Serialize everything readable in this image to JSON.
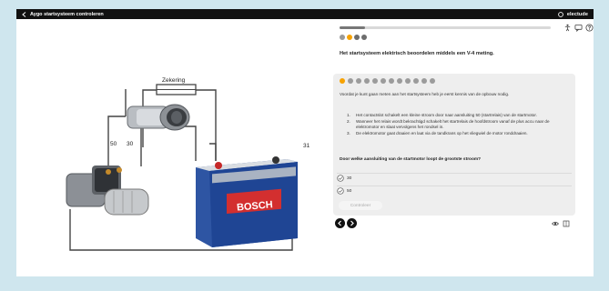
{
  "header": {
    "back_icon": "chevron-left-icon",
    "title": "Aygo startsysteem controleren",
    "brand": "electude"
  },
  "progress": {
    "fraction": 0.12
  },
  "steps": {
    "count": 4,
    "active_index": 1
  },
  "top_icons": [
    "accessibility-icon",
    "chat-icon",
    "help-icon"
  ],
  "section_title": "Het startsysteem elektrisch beoordelen middels een V-4 meting.",
  "diagram": {
    "fuse_label": "Zekering",
    "terminal_50": "50",
    "terminal_30": "30",
    "terminal_31": "31",
    "battery_brand": "BOSCH"
  },
  "question_card": {
    "dot_count": 12,
    "active_dot": 0,
    "intro": "Voordat je kunt gaan meten aan het startsysteem heb je eerst kennis van de opbouw nodig.",
    "steps": [
      {
        "n": "1.",
        "text": "Het contactslot schakelt een kleine stroom door naar aansluiting 50 (startrelais) van de startmotor."
      },
      {
        "n": "2.",
        "text": "Wanneer het relais wordt bekrachtigd schakelt het startrelais de hoofdstroom vanaf de plus accu naar de elektromotor en slaat vervolgens het rondsel in."
      },
      {
        "n": "3.",
        "text": "De elektromotor gaat draaien en laat via de tandkrans op het vliegwiel de motor ronddraaien."
      }
    ],
    "question": "Door welke aansluiting van de startmotor loopt de grootste stroom?",
    "options": [
      "30",
      "50"
    ],
    "check_label": "Controleer"
  },
  "nav": {
    "prev_icon": "arrow-left-icon",
    "next_icon": "arrow-right-icon"
  },
  "bottom_icons": [
    "eye-icon",
    "book-icon"
  ]
}
